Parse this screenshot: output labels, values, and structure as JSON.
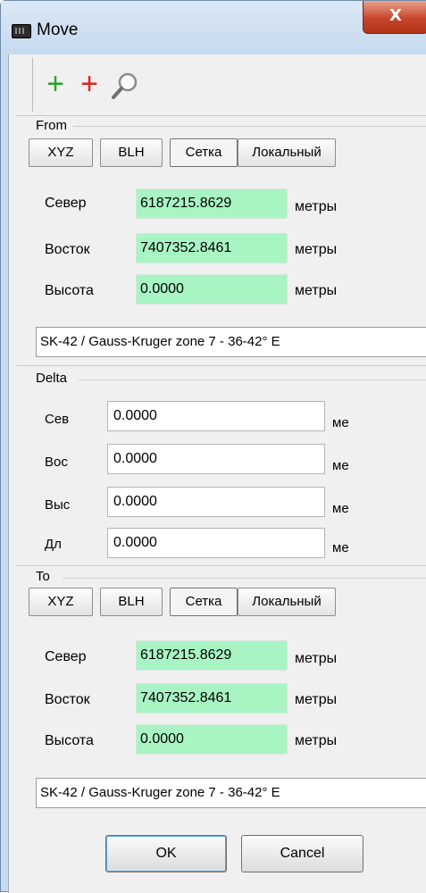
{
  "window": {
    "title": "Move",
    "close_symbol": "X"
  },
  "toolbar": {
    "add_green": "+",
    "add_red": "+",
    "search": "search"
  },
  "from": {
    "title": "From",
    "tabs": [
      "XYZ",
      "BLH",
      "Сетка",
      "Локальный"
    ],
    "active_tab": "Сетка",
    "rows": [
      {
        "label": "Север",
        "value": "6187215.8629",
        "unit": "метры"
      },
      {
        "label": "Восток",
        "value": "7407352.8461",
        "unit": "метры"
      },
      {
        "label": "Высота",
        "value": "0.0000",
        "unit": "метры"
      }
    ],
    "crs": "SK-42 / Gauss-Kruger zone 7 - 36-42° E"
  },
  "delta": {
    "title": "Delta",
    "rows": [
      {
        "label": "Сев",
        "value": "0.0000",
        "unit": "ме"
      },
      {
        "label": "Вос",
        "value": "0.0000",
        "unit": "ме"
      },
      {
        "label": "Выс",
        "value": "0.0000",
        "unit": "ме"
      },
      {
        "label": "Дл",
        "value": "0.0000",
        "unit": "ме"
      }
    ]
  },
  "to": {
    "title": "To",
    "tabs": [
      "XYZ",
      "BLH",
      "Сетка",
      "Локальный"
    ],
    "active_tab": "Сетка",
    "rows": [
      {
        "label": "Север",
        "value": "6187215.8629",
        "unit": "метры"
      },
      {
        "label": "Восток",
        "value": "7407352.8461",
        "unit": "метры"
      },
      {
        "label": "Высота",
        "value": "0.0000",
        "unit": "метры"
      }
    ],
    "crs": "SK-42 / Gauss-Kruger zone 7 - 36-42° E"
  },
  "buttons": {
    "ok": "OK",
    "cancel": "Cancel"
  },
  "colors": {
    "value_bg": "#a9f4c3",
    "title_bar": "#c5d9ef",
    "close": "#c6452b"
  }
}
